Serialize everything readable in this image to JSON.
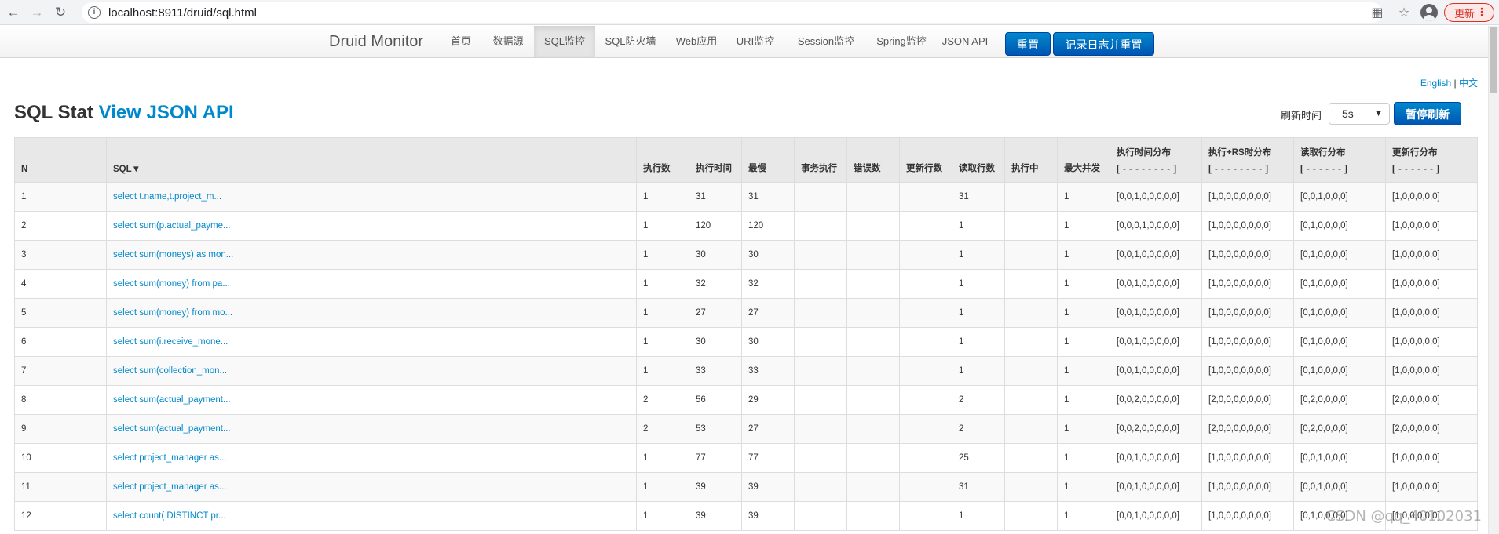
{
  "browser": {
    "url": "localhost:8911/druid/sql.html",
    "update_label": "更新"
  },
  "nav": {
    "brand": "Druid Monitor",
    "items": [
      "首页",
      "数据源",
      "SQL监控",
      "SQL防火墙",
      "Web应用",
      "URI监控",
      "Session监控",
      "Spring监控",
      "JSON API"
    ],
    "active_index": 2,
    "reset_label": "重置",
    "log_reset_label": "记录日志并重置"
  },
  "lang": {
    "english": "English",
    "separator": "|",
    "chinese": "中文"
  },
  "title": {
    "prefix": "SQL Stat",
    "link": "View JSON API"
  },
  "refresh": {
    "label": "刷新时间",
    "value": "5s",
    "pause_label": "暂停刷新"
  },
  "table": {
    "headers": {
      "n": "N",
      "sql": "SQL▼",
      "exec_count": "执行数",
      "exec_time": "执行时间",
      "slowest": "最慢",
      "txn_exec": "事务执行",
      "errors": "错误数",
      "update_rows": "更新行数",
      "read_rows": "读取行数",
      "running": "执行中",
      "max_concurrent": "最大并发",
      "exec_dist": "执行时间分布",
      "exec_dist_sub": "[ - - - - - - - - ]",
      "exec_rs_dist": "执行+RS时分布",
      "exec_rs_dist_sub": "[ - - - - - - - - ]",
      "read_dist": "读取行分布",
      "read_dist_sub": "[ - - - - - - ]",
      "update_dist": "更新行分布",
      "update_dist_sub": "[ - - - - - - ]"
    },
    "rows": [
      {
        "n": "1",
        "sql": "select t.name,t.project_m...",
        "exec_count": "1",
        "exec_time": "31",
        "slowest": "31",
        "txn": "",
        "errors": "",
        "update_rows": "",
        "read_rows": "31",
        "running": "",
        "max_conc": "1",
        "exec_dist": "[0,0,1,0,0,0,0,0]",
        "exec_rs_dist": "[1,0,0,0,0,0,0,0]",
        "read_dist": "[0,0,1,0,0,0]",
        "update_dist": "[1,0,0,0,0,0]"
      },
      {
        "n": "2",
        "sql": "select sum(p.actual_payme...",
        "exec_count": "1",
        "exec_time": "120",
        "slowest": "120",
        "txn": "",
        "errors": "",
        "update_rows": "",
        "read_rows": "1",
        "running": "",
        "max_conc": "1",
        "exec_dist": "[0,0,0,1,0,0,0,0]",
        "exec_rs_dist": "[1,0,0,0,0,0,0,0]",
        "read_dist": "[0,1,0,0,0,0]",
        "update_dist": "[1,0,0,0,0,0]"
      },
      {
        "n": "3",
        "sql": "select sum(moneys) as mon...",
        "exec_count": "1",
        "exec_time": "30",
        "slowest": "30",
        "txn": "",
        "errors": "",
        "update_rows": "",
        "read_rows": "1",
        "running": "",
        "max_conc": "1",
        "exec_dist": "[0,0,1,0,0,0,0,0]",
        "exec_rs_dist": "[1,0,0,0,0,0,0,0]",
        "read_dist": "[0,1,0,0,0,0]",
        "update_dist": "[1,0,0,0,0,0]"
      },
      {
        "n": "4",
        "sql": "select sum(money) from pa...",
        "exec_count": "1",
        "exec_time": "32",
        "slowest": "32",
        "txn": "",
        "errors": "",
        "update_rows": "",
        "read_rows": "1",
        "running": "",
        "max_conc": "1",
        "exec_dist": "[0,0,1,0,0,0,0,0]",
        "exec_rs_dist": "[1,0,0,0,0,0,0,0]",
        "read_dist": "[0,1,0,0,0,0]",
        "update_dist": "[1,0,0,0,0,0]"
      },
      {
        "n": "5",
        "sql": "select sum(money) from mo...",
        "exec_count": "1",
        "exec_time": "27",
        "slowest": "27",
        "txn": "",
        "errors": "",
        "update_rows": "",
        "read_rows": "1",
        "running": "",
        "max_conc": "1",
        "exec_dist": "[0,0,1,0,0,0,0,0]",
        "exec_rs_dist": "[1,0,0,0,0,0,0,0]",
        "read_dist": "[0,1,0,0,0,0]",
        "update_dist": "[1,0,0,0,0,0]"
      },
      {
        "n": "6",
        "sql": "select sum(i.receive_mone...",
        "exec_count": "1",
        "exec_time": "30",
        "slowest": "30",
        "txn": "",
        "errors": "",
        "update_rows": "",
        "read_rows": "1",
        "running": "",
        "max_conc": "1",
        "exec_dist": "[0,0,1,0,0,0,0,0]",
        "exec_rs_dist": "[1,0,0,0,0,0,0,0]",
        "read_dist": "[0,1,0,0,0,0]",
        "update_dist": "[1,0,0,0,0,0]"
      },
      {
        "n": "7",
        "sql": "select sum(collection_mon...",
        "exec_count": "1",
        "exec_time": "33",
        "slowest": "33",
        "txn": "",
        "errors": "",
        "update_rows": "",
        "read_rows": "1",
        "running": "",
        "max_conc": "1",
        "exec_dist": "[0,0,1,0,0,0,0,0]",
        "exec_rs_dist": "[1,0,0,0,0,0,0,0]",
        "read_dist": "[0,1,0,0,0,0]",
        "update_dist": "[1,0,0,0,0,0]"
      },
      {
        "n": "8",
        "sql": "select sum(actual_payment...",
        "exec_count": "2",
        "exec_time": "56",
        "slowest": "29",
        "txn": "",
        "errors": "",
        "update_rows": "",
        "read_rows": "2",
        "running": "",
        "max_conc": "1",
        "exec_dist": "[0,0,2,0,0,0,0,0]",
        "exec_rs_dist": "[2,0,0,0,0,0,0,0]",
        "read_dist": "[0,2,0,0,0,0]",
        "update_dist": "[2,0,0,0,0,0]"
      },
      {
        "n": "9",
        "sql": "select sum(actual_payment...",
        "exec_count": "2",
        "exec_time": "53",
        "slowest": "27",
        "txn": "",
        "errors": "",
        "update_rows": "",
        "read_rows": "2",
        "running": "",
        "max_conc": "1",
        "exec_dist": "[0,0,2,0,0,0,0,0]",
        "exec_rs_dist": "[2,0,0,0,0,0,0,0]",
        "read_dist": "[0,2,0,0,0,0]",
        "update_dist": "[2,0,0,0,0,0]"
      },
      {
        "n": "10",
        "sql": "select project_manager as...",
        "exec_count": "1",
        "exec_time": "77",
        "slowest": "77",
        "txn": "",
        "errors": "",
        "update_rows": "",
        "read_rows": "25",
        "running": "",
        "max_conc": "1",
        "exec_dist": "[0,0,1,0,0,0,0,0]",
        "exec_rs_dist": "[1,0,0,0,0,0,0,0]",
        "read_dist": "[0,0,1,0,0,0]",
        "update_dist": "[1,0,0,0,0,0]"
      },
      {
        "n": "11",
        "sql": "select project_manager as...",
        "exec_count": "1",
        "exec_time": "39",
        "slowest": "39",
        "txn": "",
        "errors": "",
        "update_rows": "",
        "read_rows": "31",
        "running": "",
        "max_conc": "1",
        "exec_dist": "[0,0,1,0,0,0,0,0]",
        "exec_rs_dist": "[1,0,0,0,0,0,0,0]",
        "read_dist": "[0,0,1,0,0,0]",
        "update_dist": "[1,0,0,0,0,0]"
      },
      {
        "n": "12",
        "sql": "select count( DISTINCT pr...",
        "exec_count": "1",
        "exec_time": "39",
        "slowest": "39",
        "txn": "",
        "errors": "",
        "update_rows": "",
        "read_rows": "1",
        "running": "",
        "max_conc": "1",
        "exec_dist": "[0,0,1,0,0,0,0,0]",
        "exec_rs_dist": "[1,0,0,0,0,0,0,0]",
        "read_dist": "[0,1,0,0,0,0]",
        "update_dist": "[1,0,0,0,0,0]"
      }
    ]
  },
  "watermark": "CSDN @qq_40102031"
}
